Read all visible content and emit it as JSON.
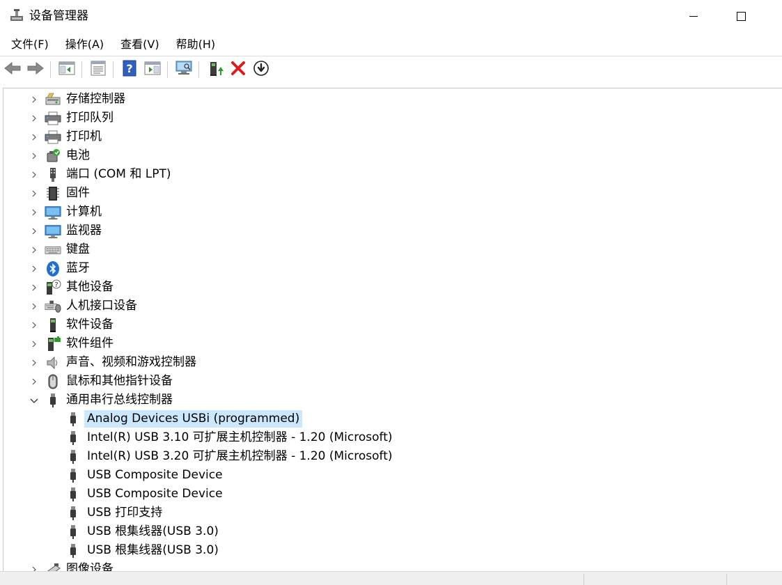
{
  "window": {
    "title": "设备管理器"
  },
  "menu": [
    {
      "label": "文件(F)"
    },
    {
      "label": "操作(A)"
    },
    {
      "label": "查看(V)"
    },
    {
      "label": "帮助(H)"
    }
  ],
  "toolbar": {
    "buttons": [
      {
        "icon": "back-arrow-icon"
      },
      {
        "icon": "forward-arrow-icon"
      },
      {
        "icon": "show-hide-console-tree-icon"
      },
      {
        "icon": "properties-icon"
      },
      {
        "icon": "help-icon"
      },
      {
        "icon": "show-hide-action-pane-icon"
      },
      {
        "icon": "scan-hardware-changes-icon"
      },
      {
        "icon": "update-driver-icon"
      },
      {
        "icon": "uninstall-device-icon"
      },
      {
        "icon": "disable-device-icon"
      }
    ]
  },
  "tree": {
    "categories": [
      {
        "label": "存储控制器",
        "icon": "storage-controller-icon",
        "expanded": false
      },
      {
        "label": "打印队列",
        "icon": "print-queue-icon",
        "expanded": false
      },
      {
        "label": "打印机",
        "icon": "printer-icon",
        "expanded": false
      },
      {
        "label": "电池",
        "icon": "battery-icon",
        "expanded": false
      },
      {
        "label": "端口 (COM 和 LPT)",
        "icon": "port-icon",
        "expanded": false
      },
      {
        "label": "固件",
        "icon": "firmware-icon",
        "expanded": false
      },
      {
        "label": "计算机",
        "icon": "computer-icon",
        "expanded": false
      },
      {
        "label": "监视器",
        "icon": "monitor-icon",
        "expanded": false
      },
      {
        "label": "键盘",
        "icon": "keyboard-icon",
        "expanded": false
      },
      {
        "label": "蓝牙",
        "icon": "bluetooth-icon",
        "expanded": false
      },
      {
        "label": "其他设备",
        "icon": "other-devices-icon",
        "expanded": false
      },
      {
        "label": "人机接口设备",
        "icon": "hid-icon",
        "expanded": false
      },
      {
        "label": "软件设备",
        "icon": "software-device-icon",
        "expanded": false
      },
      {
        "label": "软件组件",
        "icon": "software-component-icon",
        "expanded": false
      },
      {
        "label": "声音、视频和游戏控制器",
        "icon": "sound-icon",
        "expanded": false
      },
      {
        "label": "鼠标和其他指针设备",
        "icon": "mouse-icon",
        "expanded": false
      },
      {
        "label": "通用串行总线控制器",
        "icon": "usb-icon",
        "expanded": true
      }
    ],
    "usb_children": [
      {
        "label": "Analog Devices USBi (programmed)",
        "selected": true
      },
      {
        "label": "Intel(R) USB 3.10 可扩展主机控制器 - 1.20 (Microsoft)",
        "selected": false
      },
      {
        "label": "Intel(R) USB 3.20 可扩展主机控制器 - 1.20 (Microsoft)",
        "selected": false
      },
      {
        "label": "USB Composite Device",
        "selected": false
      },
      {
        "label": "USB Composite Device",
        "selected": false
      },
      {
        "label": "USB 打印支持",
        "selected": false
      },
      {
        "label": "USB 根集线器(USB 3.0)",
        "selected": false
      },
      {
        "label": "USB 根集线器(USB 3.0)",
        "selected": false
      }
    ],
    "after": [
      {
        "label": "图像设备",
        "icon": "imaging-device-icon",
        "expanded": false
      }
    ]
  }
}
